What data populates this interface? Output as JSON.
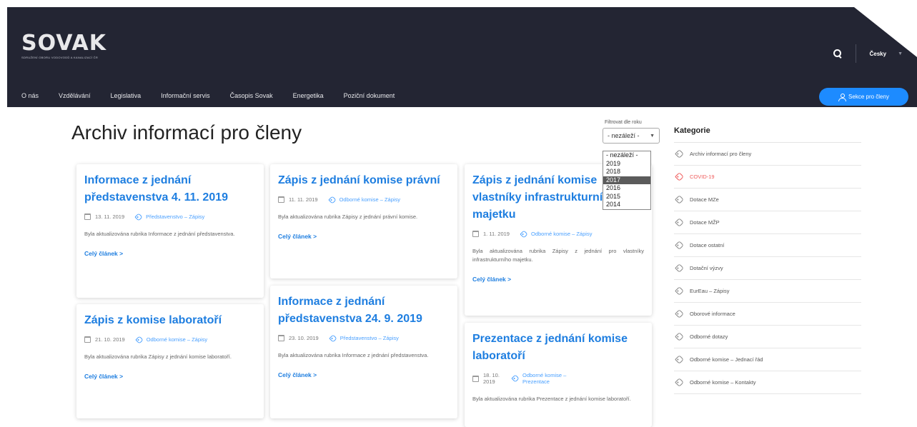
{
  "brand": {
    "logo_text": "SOVAK",
    "logo_subtitle": "Sdružení oboru vodovodů a kanalizací ČR"
  },
  "header": {
    "language": "Česky",
    "members_button": "Sekce pro členy"
  },
  "nav": [
    "O nás",
    "Vzdělávání",
    "Legislativa",
    "Informační servis",
    "Časopis Sovak",
    "Energetika",
    "Poziční dokument"
  ],
  "page": {
    "title": "Archiv informací pro členy"
  },
  "filter": {
    "label": "Filtrovat dle roku",
    "selected": "- nezáleží -",
    "options": [
      "- nezáleží -",
      "2019",
      "2018",
      "2017",
      "2016",
      "2015",
      "2014"
    ],
    "highlighted": "2017"
  },
  "cards": [
    {
      "title": "Informace z jednání představenstva 4. 11. 2019",
      "date": "13. 11. 2019",
      "category": "Představenstvo – Zápisy",
      "excerpt": "Byla aktualizována rubrika Informace z jednání představenstva.",
      "more": "Celý článek >"
    },
    {
      "title": "Zápis z jednání komise právní",
      "date": "11. 11. 2019",
      "category": "Odborné komise – Zápisy",
      "excerpt": "Byla aktualizována rubrika Zápisy z jednání právní komise.",
      "more": "Celý článek >"
    },
    {
      "title": "Zápis z jednání komise vlastníky infrastrukturní majetku",
      "date": "1. 11. 2019",
      "category": "Odborné komise – Zápisy",
      "excerpt": "Byla aktualizována rubrika Zápisy z jednání pro vlastníky infrastrukturního majetku.",
      "more": "Celý článek >"
    },
    {
      "title": "Zápis z komise laboratoří",
      "date": "21. 10. 2019",
      "category": "Odborné komise – Zápisy",
      "excerpt": "Byla aktualizována rubrika Zápisy z jednání komise laboratoří.",
      "more": "Celý článek >"
    },
    {
      "title": "Informace z jednání představenstva 24. 9. 2019",
      "date": "23. 10. 2019",
      "category": "Představenstvo – Zápisy",
      "excerpt": "Byla aktualizována rubrika Informace z jednání představenstva.",
      "more": "Celý článek >"
    },
    {
      "title": "Prezentace z jednání komise laboratoří",
      "date": "18. 10. 2019",
      "category": "Odborné komise – Prezentace",
      "excerpt": "Byla aktualizována rubrika Prezentace z jednání komise laboratoří.",
      "more": "Celý článek >"
    }
  ],
  "sidebar": {
    "title": "Kategorie",
    "items": [
      "Archiv informací pro členy",
      "COVID-19",
      "Dotace MZe",
      "Dotace MŽP",
      "Dotace ostatní",
      "Dotační výzvy",
      "EurEau – Zápisy",
      "Oborové informace",
      "Odborné dotazy",
      "Odborné komise – Jednací řád",
      "Odborné komise – Kontakty"
    ],
    "highlight_color": "#ef5a5a"
  },
  "colors": {
    "header_bg": "#232533",
    "accent_blue": "#1e7ee0",
    "button_blue": "#1d8bff"
  }
}
